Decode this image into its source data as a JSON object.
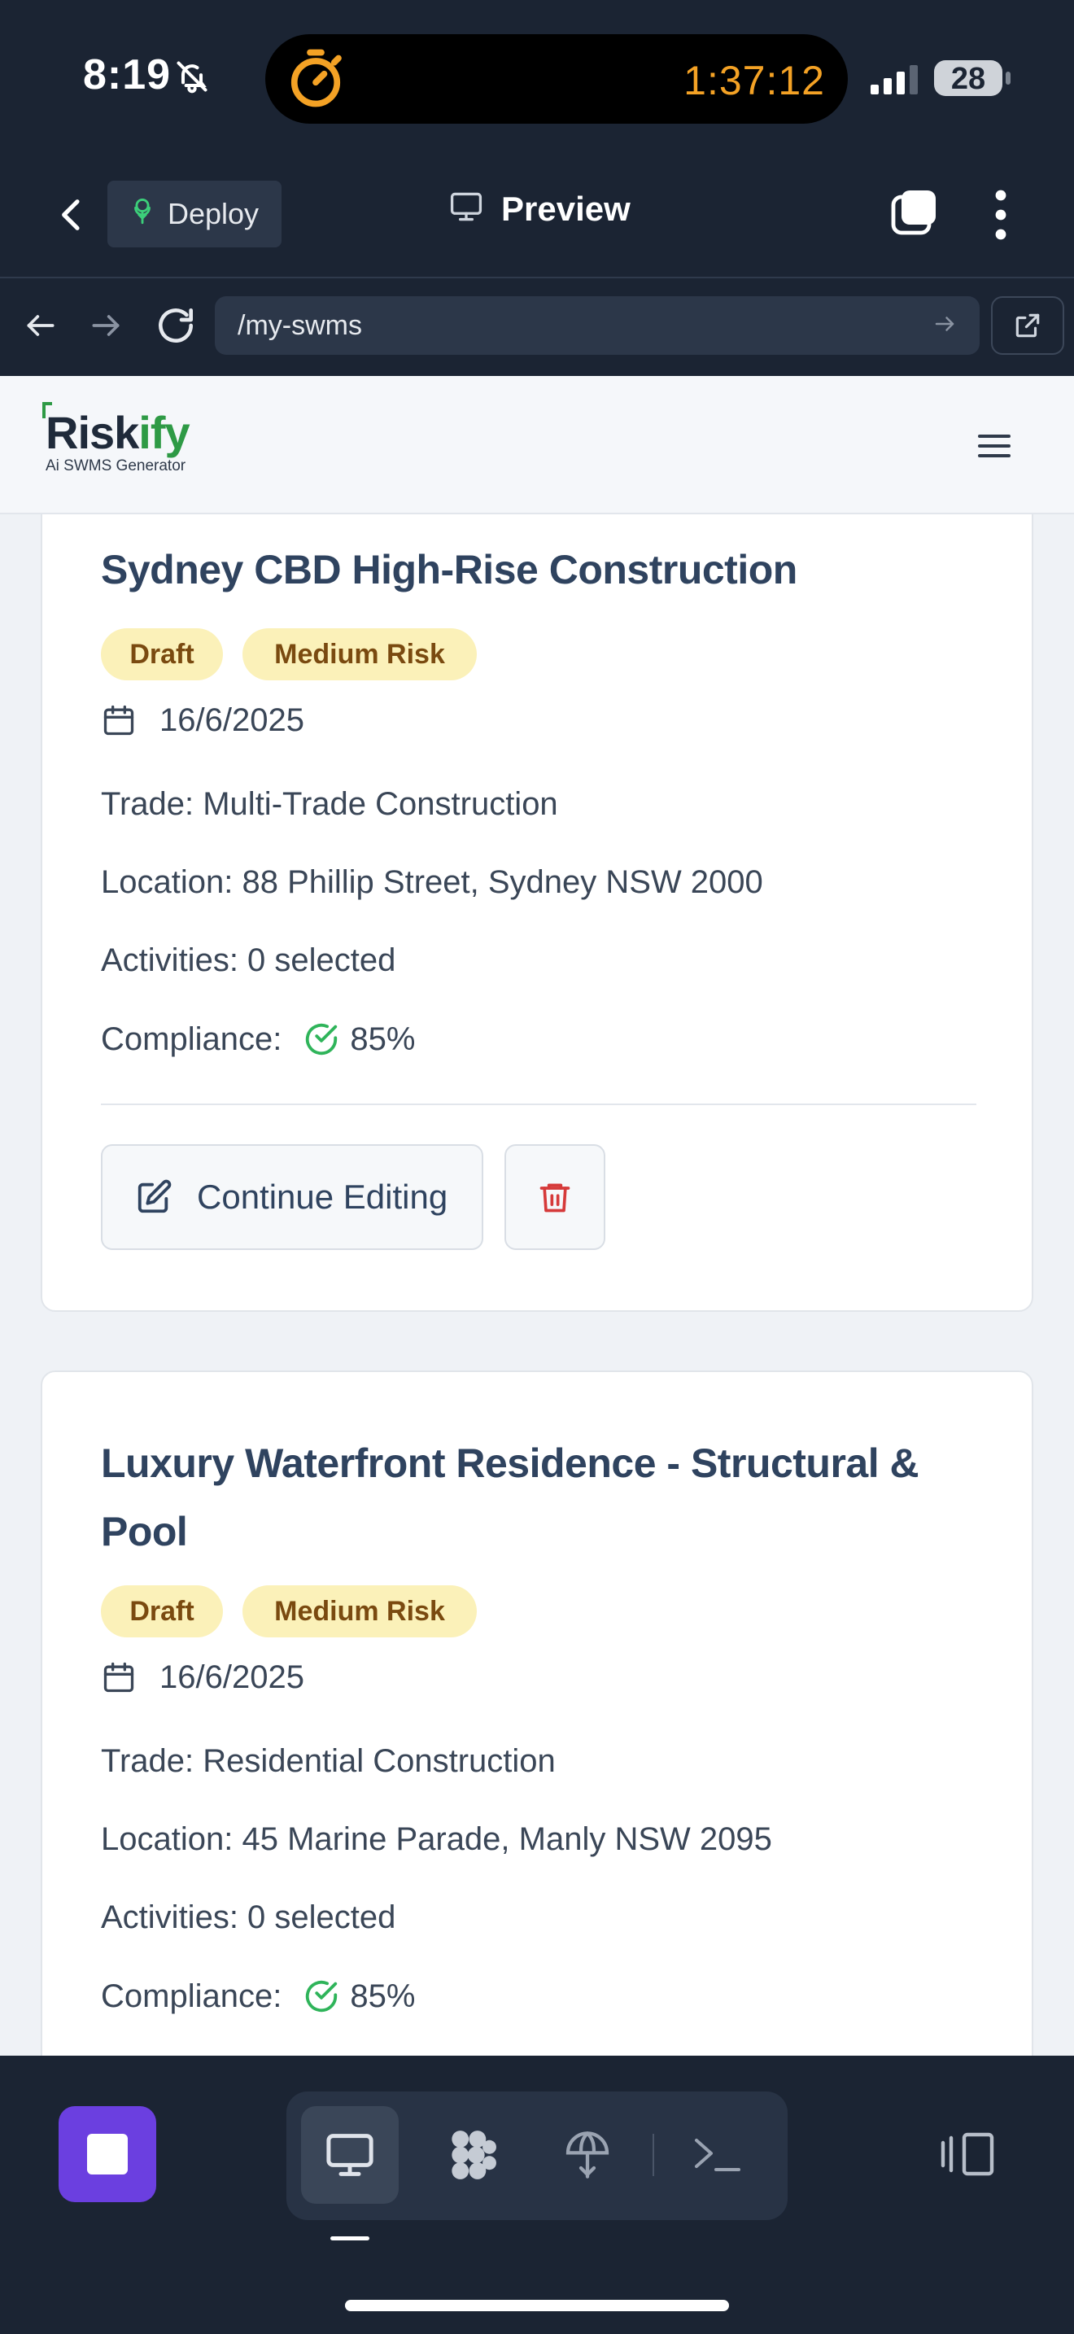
{
  "status_bar": {
    "time": "8:19",
    "timer": "1:37:12",
    "battery": "28",
    "icons": [
      "bell-slash-icon",
      "stopwatch-icon",
      "signal-icon",
      "battery-icon"
    ]
  },
  "browser_header": {
    "deploy_label": "Deploy",
    "preview_label": "Preview",
    "icons": [
      "chevron-left-icon",
      "deploy-icon",
      "monitor-icon",
      "tabs-icon",
      "more-vertical-icon"
    ]
  },
  "url_bar": {
    "url": "/my-swms",
    "icons": [
      "arrow-left-icon",
      "arrow-right-icon",
      "refresh-icon",
      "go-arrow-icon",
      "external-link-icon"
    ]
  },
  "site": {
    "logo_text_1": "Risk",
    "logo_text_2": "ify",
    "logo_tagline": "Ai SWMS Generator"
  },
  "cards": [
    {
      "title": "Sydney CBD High-Rise Construction",
      "status": "Draft",
      "risk": "Medium Risk",
      "date": "16/6/2025",
      "trade": "Trade: Multi-Trade Construction",
      "location": "Location: 88 Phillip Street, Sydney NSW 2000",
      "activities": "Activities: 0 selected",
      "compliance_label": "Compliance:",
      "compliance_value": "85%",
      "continue_label": "Continue Editing"
    },
    {
      "title": "Luxury Waterfront Residence - Structural & Pool",
      "status": "Draft",
      "risk": "Medium Risk",
      "date": "16/6/2025",
      "trade": "Trade: Residential Construction",
      "location": "Location: 45 Marine Parade, Manly NSW 2095",
      "activities": "Activities: 0 selected",
      "compliance_label": "Compliance:",
      "compliance_value": "85%"
    }
  ],
  "colors": {
    "chrome_bg": "#1b2433",
    "accent_purple": "#6b3fe0",
    "badge_bg": "#fbf1b9",
    "badge_text": "#7a4a10",
    "success_green": "#2fb45a",
    "danger_red": "#d63a3a",
    "timer_orange": "#f4a225"
  }
}
